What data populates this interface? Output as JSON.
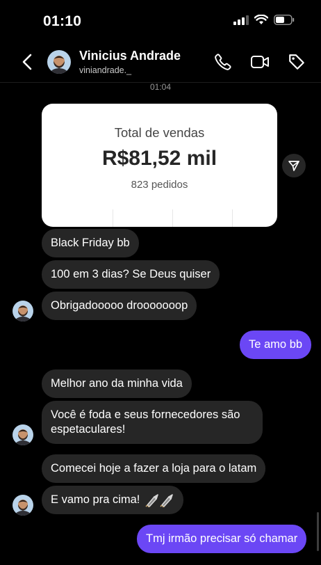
{
  "status_bar": {
    "time": "01:10"
  },
  "header": {
    "contact_name": "Vinicius Andrade",
    "contact_handle": "viniandrade._"
  },
  "chat": {
    "timestamp": "01:04",
    "shared_card": {
      "title": "Total de vendas",
      "value": "R$81,52 mil",
      "orders": "823 pedidos"
    },
    "messages": [
      {
        "sender": "them",
        "text": "Black Friday bb"
      },
      {
        "sender": "them",
        "text": "100 em 3 dias? Se Deus quiser"
      },
      {
        "sender": "them",
        "text": "Obrigadooooo drooooooop"
      },
      {
        "sender": "me",
        "text": "Te amo bb"
      },
      {
        "sender": "them",
        "text": "Melhor ano da minha vida"
      },
      {
        "sender": "them",
        "text": "Você é foda e seus fornecedores são espetaculares!"
      },
      {
        "sender": "them",
        "text": "Comecei hoje a fazer a loja para o latam"
      },
      {
        "sender": "them",
        "text": "E vamo pra cima!"
      },
      {
        "sender": "me",
        "text": "Tmj irmão precisar só chamar"
      }
    ]
  },
  "colors": {
    "background": "#000000",
    "incoming_bubble": "#262626",
    "outgoing_bubble": "#6b47f5",
    "card": "#ffffff"
  }
}
